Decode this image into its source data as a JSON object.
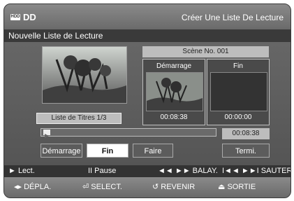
{
  "header": {
    "badge": "HDD",
    "app": "DD",
    "title": "Créer Une Liste De Lecture"
  },
  "subtitle": "Nouvelle Liste de Lecture",
  "left_panel": {
    "titles_label": "Liste de Titres 1/3"
  },
  "scene": {
    "label": "Scène No. 001",
    "start": {
      "label": "Démarrage",
      "time": "00:08:38"
    },
    "end": {
      "label": "Fin",
      "time": "00:00:00"
    }
  },
  "progress": {
    "current_time": "00:08:38"
  },
  "buttons": {
    "start": "Démarrage",
    "end": "Fin",
    "make": "Faire",
    "finish": "Termi."
  },
  "controls": {
    "play": "► Lect.",
    "pause": "II Pause",
    "scan": "◄◄ ►► BALAY.",
    "skip": "I◄◄ ►►I SAUTER"
  },
  "nav": {
    "move": "DÉPLA.",
    "select": "SELECT.",
    "back": "REVENIR",
    "exit": "SORTIE"
  }
}
